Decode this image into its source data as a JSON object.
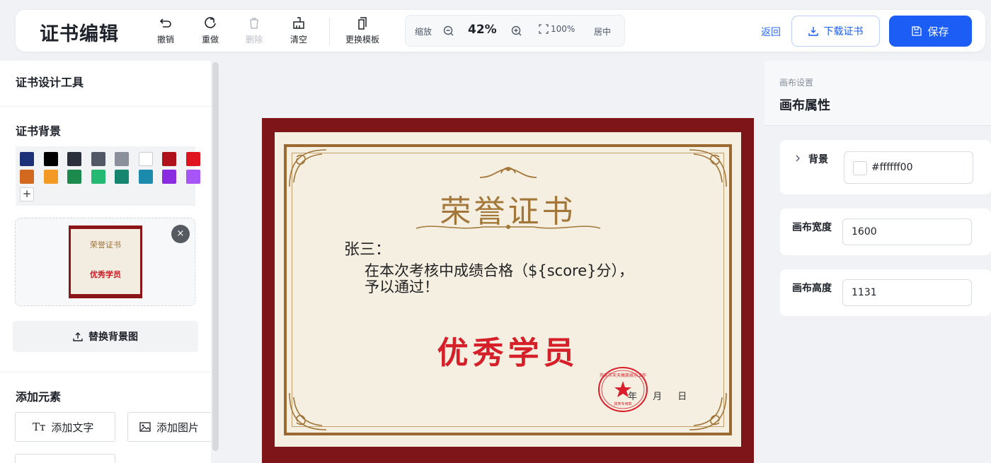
{
  "header": {
    "title": "证书编辑",
    "tools": {
      "undo": "撤销",
      "redo": "重做",
      "delete": "删除",
      "clear": "清空",
      "template": "更换模板"
    },
    "zoom": {
      "label": "缩放",
      "value": "42%",
      "fit": "100%",
      "center": "居中"
    },
    "back": "返回",
    "download": "下载证书",
    "save": "保存"
  },
  "left_panel": {
    "title": "证书设计工具",
    "background_section": "证书背景",
    "swatches": [
      "#1c3178",
      "#000000",
      "#2b313c",
      "#525866",
      "#8c909b",
      "#ffffff",
      "#b0121c",
      "#e0141e",
      "#d2691e",
      "#f39a24",
      "#1b8a4c",
      "#25ba73",
      "#15856f",
      "#1a8aad",
      "#8a2be2",
      "#a855f7"
    ],
    "add_swatch": "+",
    "thumbnail": {
      "title": "荣誉证书",
      "award": "优秀学员"
    },
    "remove_icon": "×",
    "replace_bg": "替换背景图",
    "add_section": "添加元素",
    "add_text": "添加文字",
    "add_image": "添加图片",
    "add_text_icon": "Tт"
  },
  "certificate": {
    "title": "荣誉证书",
    "name": "张三：",
    "body_line1": "在本次考核中成绩合格（${score}分），",
    "body_line2": "予以通过！",
    "award": "优秀学员",
    "date": "年 月 日",
    "seal_text": "开元市天天搞笑娱乐工作",
    "seal_sub": "搞笑专用章",
    "colors": {
      "outer": "#7e1518",
      "paper": "#f5efe2",
      "gold": "#a27739",
      "award": "#d71f2a",
      "seal": "#d91f2b"
    }
  },
  "right_panel": {
    "subtitle": "画布设置",
    "title": "画布属性",
    "background_label": "背景",
    "background_value": "#ffffff00",
    "width_label": "画布宽度",
    "width_value": "1600",
    "height_label": "画布高度",
    "height_value": "1131"
  }
}
